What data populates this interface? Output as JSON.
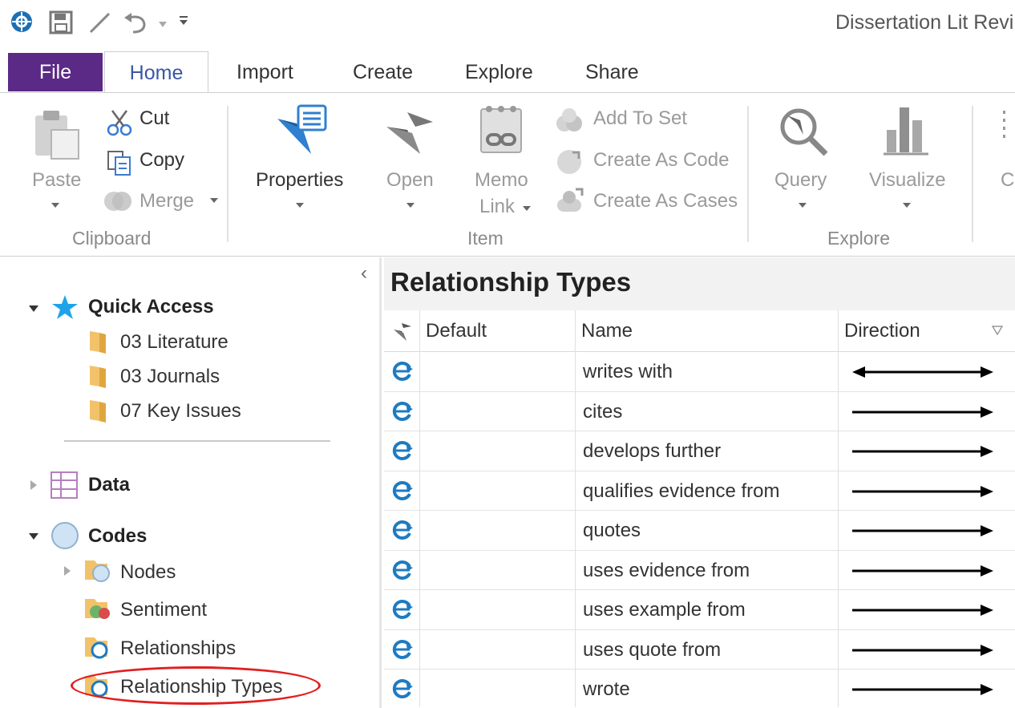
{
  "app": {
    "title": "Dissertation Lit Revi"
  },
  "quick_toolbar": {
    "icons": [
      "app-logo-icon",
      "save-icon",
      "edit-icon",
      "undo-icon",
      "dropdown-icon",
      "customize-icon"
    ]
  },
  "tabs": [
    {
      "label": "File"
    },
    {
      "label": "Home"
    },
    {
      "label": "Import"
    },
    {
      "label": "Create"
    },
    {
      "label": "Explore"
    },
    {
      "label": "Share"
    }
  ],
  "ribbon": {
    "clipboard": {
      "label": "Clipboard",
      "paste": "Paste",
      "cut": "Cut",
      "copy": "Copy",
      "merge": "Merge"
    },
    "item": {
      "label": "Item",
      "properties": "Properties",
      "open": "Open",
      "memo_line1": "Memo",
      "memo_line2": "Link",
      "add_to_set": "Add To Set",
      "create_as_code": "Create As Code",
      "create_as_cases": "Create As Cases"
    },
    "explore": {
      "label": "Explore",
      "query": "Query",
      "visualize": "Visualize",
      "partial": "C"
    }
  },
  "nav": {
    "collapse_glyph": "‹",
    "quick_access": {
      "label": "Quick Access",
      "items": [
        "03 Literature",
        "03 Journals",
        "07 Key Issues"
      ]
    },
    "data": {
      "label": "Data"
    },
    "codes": {
      "label": "Codes",
      "items": [
        "Nodes",
        "Sentiment",
        "Relationships",
        "Relationship Types"
      ]
    },
    "highlight_color": "#e02020"
  },
  "content": {
    "title": "Relationship Types",
    "columns": [
      "Default",
      "Name",
      "Direction"
    ],
    "rows": [
      {
        "name": "writes with",
        "direction": "both"
      },
      {
        "name": "cites",
        "direction": "one-way"
      },
      {
        "name": "develops further",
        "direction": "one-way"
      },
      {
        "name": "qualifies evidence from",
        "direction": "one-way"
      },
      {
        "name": "quotes",
        "direction": "one-way"
      },
      {
        "name": "uses evidence from",
        "direction": "one-way"
      },
      {
        "name": "uses example from",
        "direction": "one-way"
      },
      {
        "name": "uses quote from",
        "direction": "one-way"
      },
      {
        "name": "wrote",
        "direction": "one-way"
      }
    ]
  },
  "colors": {
    "file_tab": "#5b2a86",
    "accent_blue": "#1d7bc2",
    "star": "#1fa3e8"
  }
}
